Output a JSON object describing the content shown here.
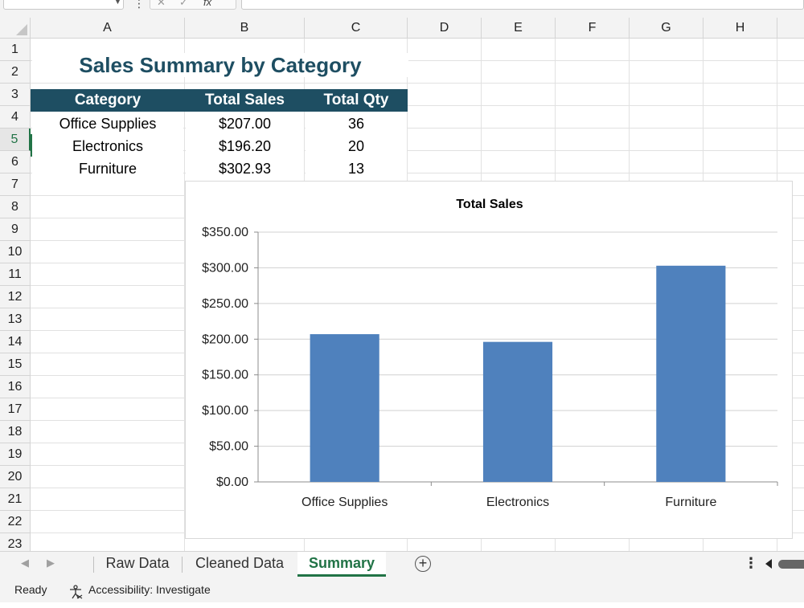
{
  "formula_bar": {
    "name_box": "",
    "fx_label": "fx",
    "formula": ""
  },
  "grid": {
    "columns": [
      "A",
      "B",
      "C",
      "D",
      "E",
      "F",
      "G",
      "H"
    ],
    "rows": [
      "1",
      "2",
      "3",
      "4",
      "5",
      "6",
      "7",
      "8",
      "9",
      "10",
      "11",
      "12",
      "13",
      "14",
      "15",
      "16",
      "17",
      "18",
      "19",
      "20",
      "21",
      "22",
      "23"
    ],
    "active_row": "5"
  },
  "sheet": {
    "title": "Sales Summary by Category",
    "headers": [
      "Category",
      "Total Sales",
      "Total Qty"
    ],
    "rows": [
      [
        "Office Supplies",
        "$207.00",
        "36"
      ],
      [
        "Electronics",
        "$196.20",
        "20"
      ],
      [
        "Furniture",
        "$302.93",
        "13"
      ]
    ]
  },
  "chart_data": {
    "type": "bar",
    "title": "Total Sales",
    "categories": [
      "Office Supplies",
      "Electronics",
      "Furniture"
    ],
    "values": [
      207.0,
      196.2,
      302.93
    ],
    "ylim": [
      0,
      350
    ],
    "yticks": [
      "$0.00",
      "$50.00",
      "$100.00",
      "$150.00",
      "$200.00",
      "$250.00",
      "$300.00",
      "$350.00"
    ],
    "grid": true,
    "legend": "none",
    "bar_color": "#4f81bd"
  },
  "tabs": [
    {
      "label": "Raw Data",
      "active": false
    },
    {
      "label": "Cleaned Data",
      "active": false
    },
    {
      "label": "Summary",
      "active": true
    }
  ],
  "add_sheet_label": "+",
  "more_label": "⋮",
  "status": {
    "ready": "Ready",
    "accessibility": "Accessibility: Investigate"
  },
  "colors": {
    "accent": "#217346",
    "header_fill": "#1e4e62",
    "bar": "#4f81bd"
  }
}
